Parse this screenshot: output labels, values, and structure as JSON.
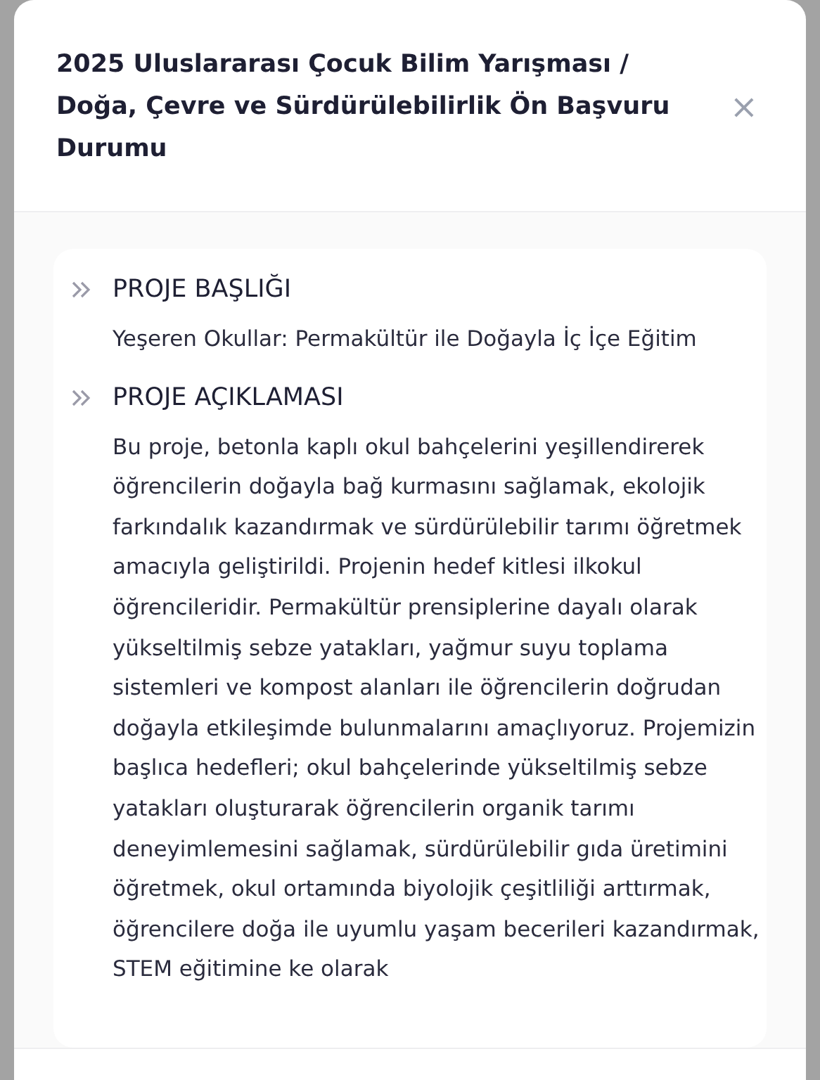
{
  "modal": {
    "title": "2025 Uluslararası Çocuk Bilim Yarışması / Doğa, Çevre ve Sürdürülebilirlik Ön Başvuru Durumu",
    "close_icon": "×"
  },
  "sections": [
    {
      "heading": "PROJE BAŞLIĞI",
      "text": "Yeşeren Okullar: Permakültür ile Doğayla İç İçe Eğitim"
    },
    {
      "heading": "PROJE AÇIKLAMASI",
      "text": "Bu proje, betonla kaplı okul bahçelerini yeşillendirerek öğrencilerin doğayla bağ kurmasını sağlamak, ekolojik farkındalık kazandırmak ve sürdürülebilir tarımı öğretmek amacıyla geliştirildi. Projenin hedef kitlesi ilkokul öğrencileridir. Permakültür prensiplerine dayalı olarak yükseltilmiş sebze yatakları, yağmur suyu toplama sistemleri ve kompost alanları ile öğrencilerin doğrudan doğayla etkileşimde bulunmalarını amaçlıyoruz. Projemizin başlıca hedefleri; okul bahçelerinde yükseltilmiş sebze yatakları oluşturarak öğrencilerin organik tarımı deneyimlemesini sağlamak, sürdürülebilir gıda üretimini öğretmek, okul ortamında biyolojik çeşitliliği arttırmak, öğrencilere doğa ile uyumlu yaşam becerileri kazandırmak, STEM eğitimine ke olarak"
    }
  ]
}
